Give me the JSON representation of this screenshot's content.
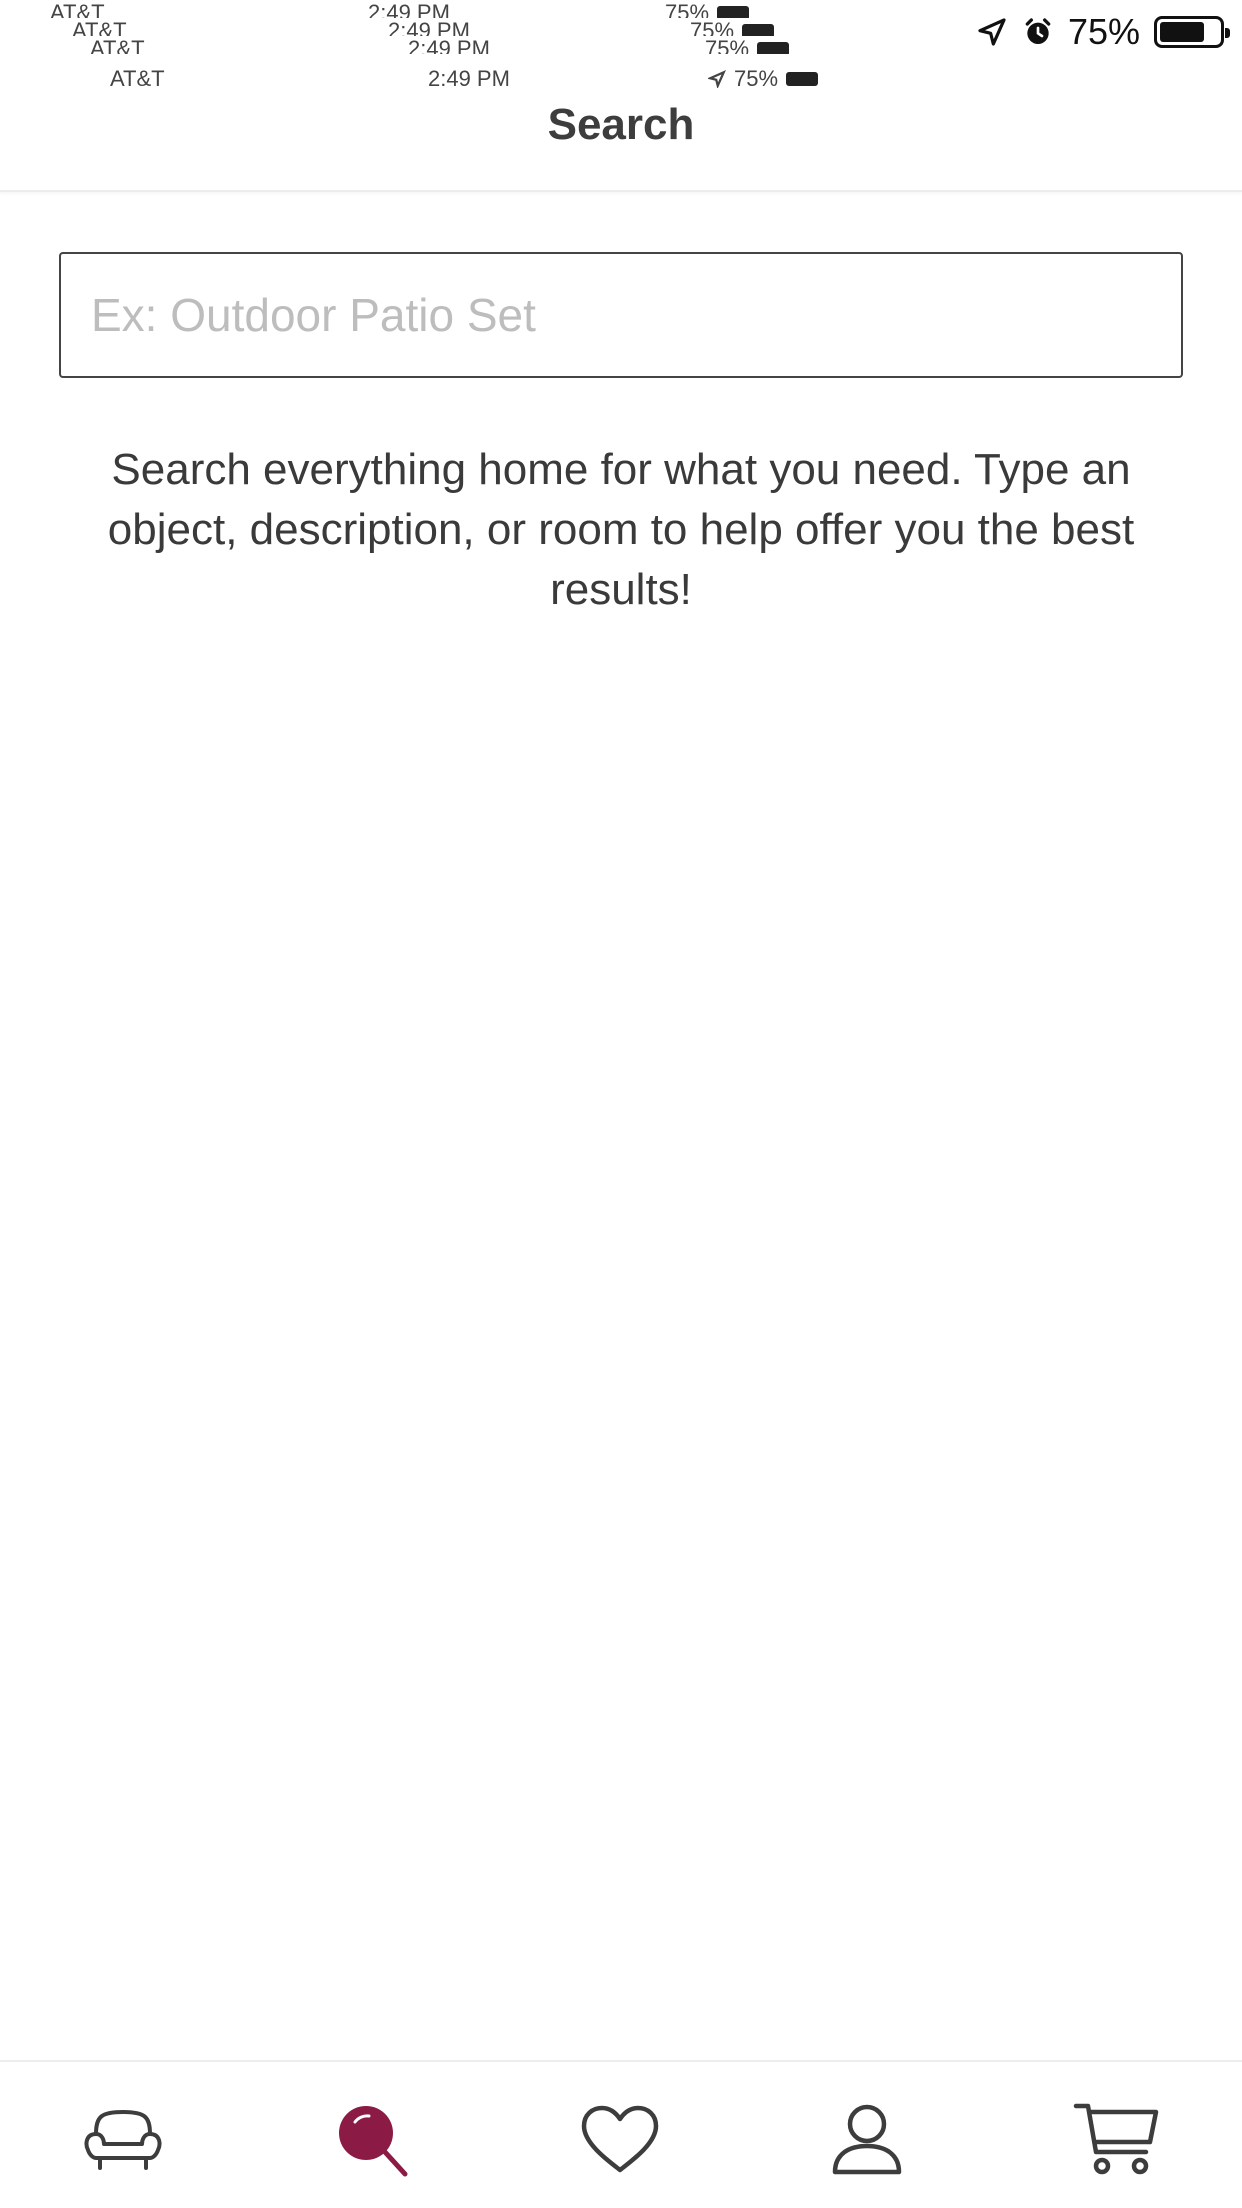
{
  "status_bar": {
    "carrier": "AT&T",
    "time": "2:49 PM",
    "battery_percent_label": "75%",
    "battery_level": 0.75
  },
  "header": {
    "title": "Search"
  },
  "search": {
    "placeholder": "Ex: Outdoor Patio Set",
    "value": ""
  },
  "help_text": "Search everything home for what you need. Type an object, description, or room to help offer you the best results!",
  "tab_bar": {
    "items": [
      {
        "icon": "sofa-icon",
        "active": false
      },
      {
        "icon": "search-icon",
        "active": true
      },
      {
        "icon": "heart-icon",
        "active": false
      },
      {
        "icon": "user-icon",
        "active": false
      },
      {
        "icon": "cart-icon",
        "active": false
      }
    ]
  },
  "colors": {
    "accent": "#8b1a45",
    "icon": "#3d3d3d",
    "placeholder": "#bdbdbd"
  }
}
